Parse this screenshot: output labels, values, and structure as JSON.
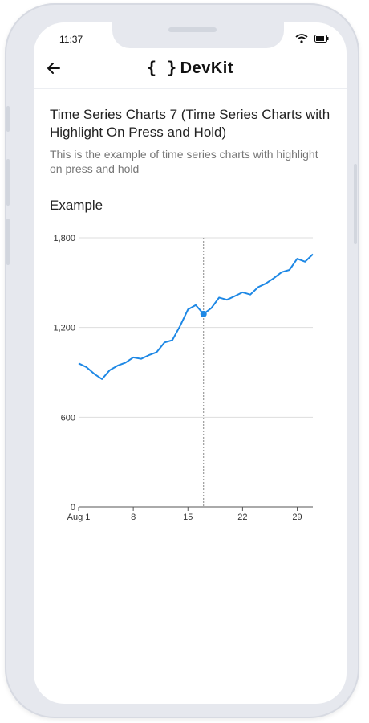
{
  "status": {
    "time": "11:37"
  },
  "appbar": {
    "brand_braces": "{ }",
    "brand_name": "DevKit"
  },
  "page": {
    "title": "Time Series Charts 7 (Time Series Charts with Highlight On Press and Hold)",
    "subtitle": "This is the example of time series charts with highlight on press and hold",
    "section_label": "Example"
  },
  "colors": {
    "line": "#1e88e5",
    "grid": "#dddddd",
    "highlight": "#888888"
  },
  "chart_data": {
    "type": "line",
    "title": "",
    "xlabel": "",
    "ylabel": "",
    "ylim": [
      0,
      1800
    ],
    "yticks": [
      0,
      600,
      1200,
      1800
    ],
    "ytick_labels": [
      "0",
      "600",
      "1,200",
      "1,800"
    ],
    "x_day_ticks": [
      1,
      8,
      15,
      22,
      29
    ],
    "xtick_labels": [
      "Aug 1",
      "8",
      "15",
      "22",
      "29"
    ],
    "grid": true,
    "highlighted_x": 17,
    "series": [
      {
        "x": [
          1,
          2,
          3,
          4,
          5,
          6,
          7,
          8,
          9,
          10,
          11,
          12,
          13,
          14,
          15,
          16,
          17,
          18,
          19,
          20,
          21,
          22,
          23,
          24,
          25,
          26,
          27,
          28,
          29,
          30,
          31
        ],
        "values": [
          960,
          935,
          890,
          855,
          915,
          945,
          965,
          1000,
          990,
          1015,
          1035,
          1100,
          1115,
          1210,
          1320,
          1350,
          1290,
          1330,
          1400,
          1385,
          1410,
          1435,
          1420,
          1470,
          1495,
          1530,
          1570,
          1585,
          1660,
          1640,
          1690
        ]
      }
    ]
  }
}
